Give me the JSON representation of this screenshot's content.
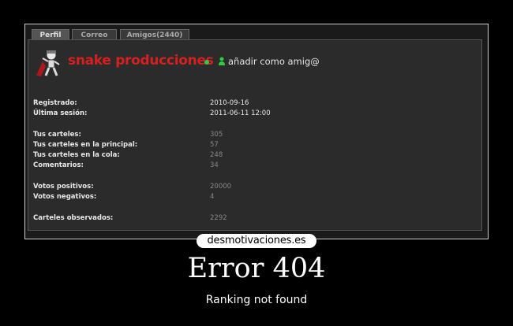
{
  "tabs": [
    {
      "label": "Perfil"
    },
    {
      "label": "Correo"
    },
    {
      "label": "Amigos(2440)"
    }
  ],
  "profile": {
    "username": "snake producciones",
    "add_friend_label": "añadir como amig@",
    "online_color": "#2ecc40",
    "username_color": "#d42020"
  },
  "stats": {
    "registrado": {
      "label": "Registrado:",
      "value": "2010-09-16"
    },
    "ultima_sesion": {
      "label": "Última sesión:",
      "value": "2011-06-11 12:00"
    },
    "tus_carteles": {
      "label": "Tus carteles:",
      "value": "305"
    },
    "carteles_principal": {
      "label": "Tus carteles en la principal:",
      "value": "57"
    },
    "carteles_cola": {
      "label": "Tus carteles en la cola:",
      "value": "248"
    },
    "comentarios": {
      "label": "Comentarios:",
      "value": "34"
    },
    "votos_positivos": {
      "label": "Votos positivos:",
      "value": "20000"
    },
    "votos_negativos": {
      "label": "Votos negativos:",
      "value": "4"
    },
    "carteles_observados": {
      "label": "Carteles observados:",
      "value": "2292"
    }
  },
  "poster": {
    "site": "desmotivaciones.es",
    "title": "Error 404",
    "subtitle": "Ranking not found"
  }
}
